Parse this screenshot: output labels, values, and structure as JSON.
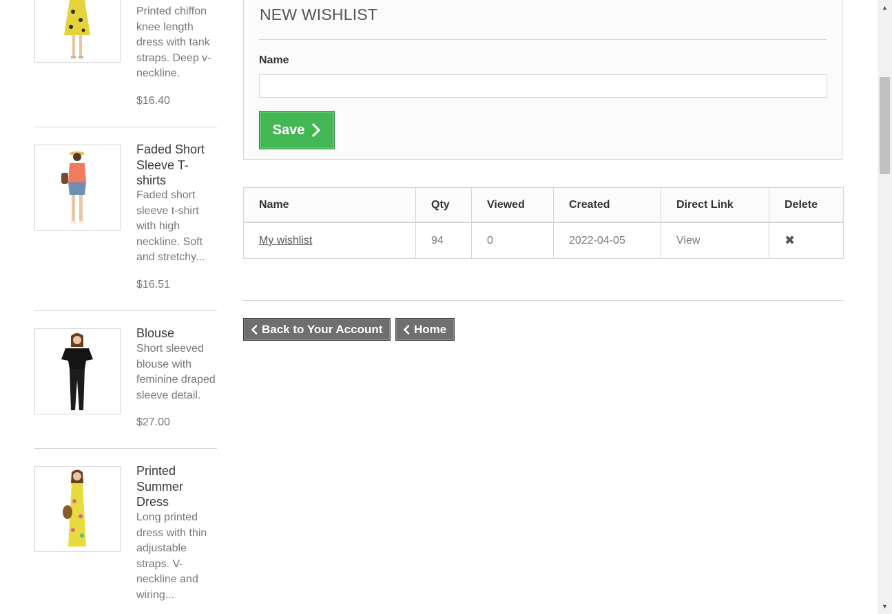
{
  "sidebar": {
    "products": [
      {
        "name": "",
        "description": "Printed chiffon knee length dress with tank straps. Deep v-neckline.",
        "price": "$16.40",
        "image_alt": "woman in yellow floral knee length dress"
      },
      {
        "name": "Faded Short Sleeve T-shirts",
        "description": "Faded short sleeve t-shirt with high neckline. Soft and stretchy...",
        "price": "$16.51",
        "image_alt": "woman in orange t-shirt and denim shorts"
      },
      {
        "name": "Blouse",
        "description": "Short sleeved blouse with feminine draped sleeve detail.",
        "price": "$27.00",
        "image_alt": "woman in black blouse"
      },
      {
        "name": "Printed Summer Dress",
        "description": "Long printed dress with thin adjustable straps. V-neckline and wiring...",
        "price": "",
        "image_alt": "woman in long yellow printed dress"
      }
    ]
  },
  "new_wishlist": {
    "title": "New wishlist",
    "name_label": "Name",
    "name_value": "",
    "name_placeholder": "",
    "save_label": "Save"
  },
  "wishlist_table": {
    "headers": [
      "Name",
      "Qty",
      "Viewed",
      "Created",
      "Direct Link",
      "Delete"
    ],
    "rows": [
      {
        "name": "My wishlist",
        "qty": "94",
        "viewed": "0",
        "created": "2022-04-05",
        "direct_link": "View",
        "delete_icon": "close-icon"
      }
    ]
  },
  "footer_nav": {
    "back_label": "Back to Your Account",
    "home_label": "Home"
  },
  "colors": {
    "save_green": "#43b754",
    "nav_gray": "#6f6f6f",
    "border": "#d6d4d4"
  }
}
